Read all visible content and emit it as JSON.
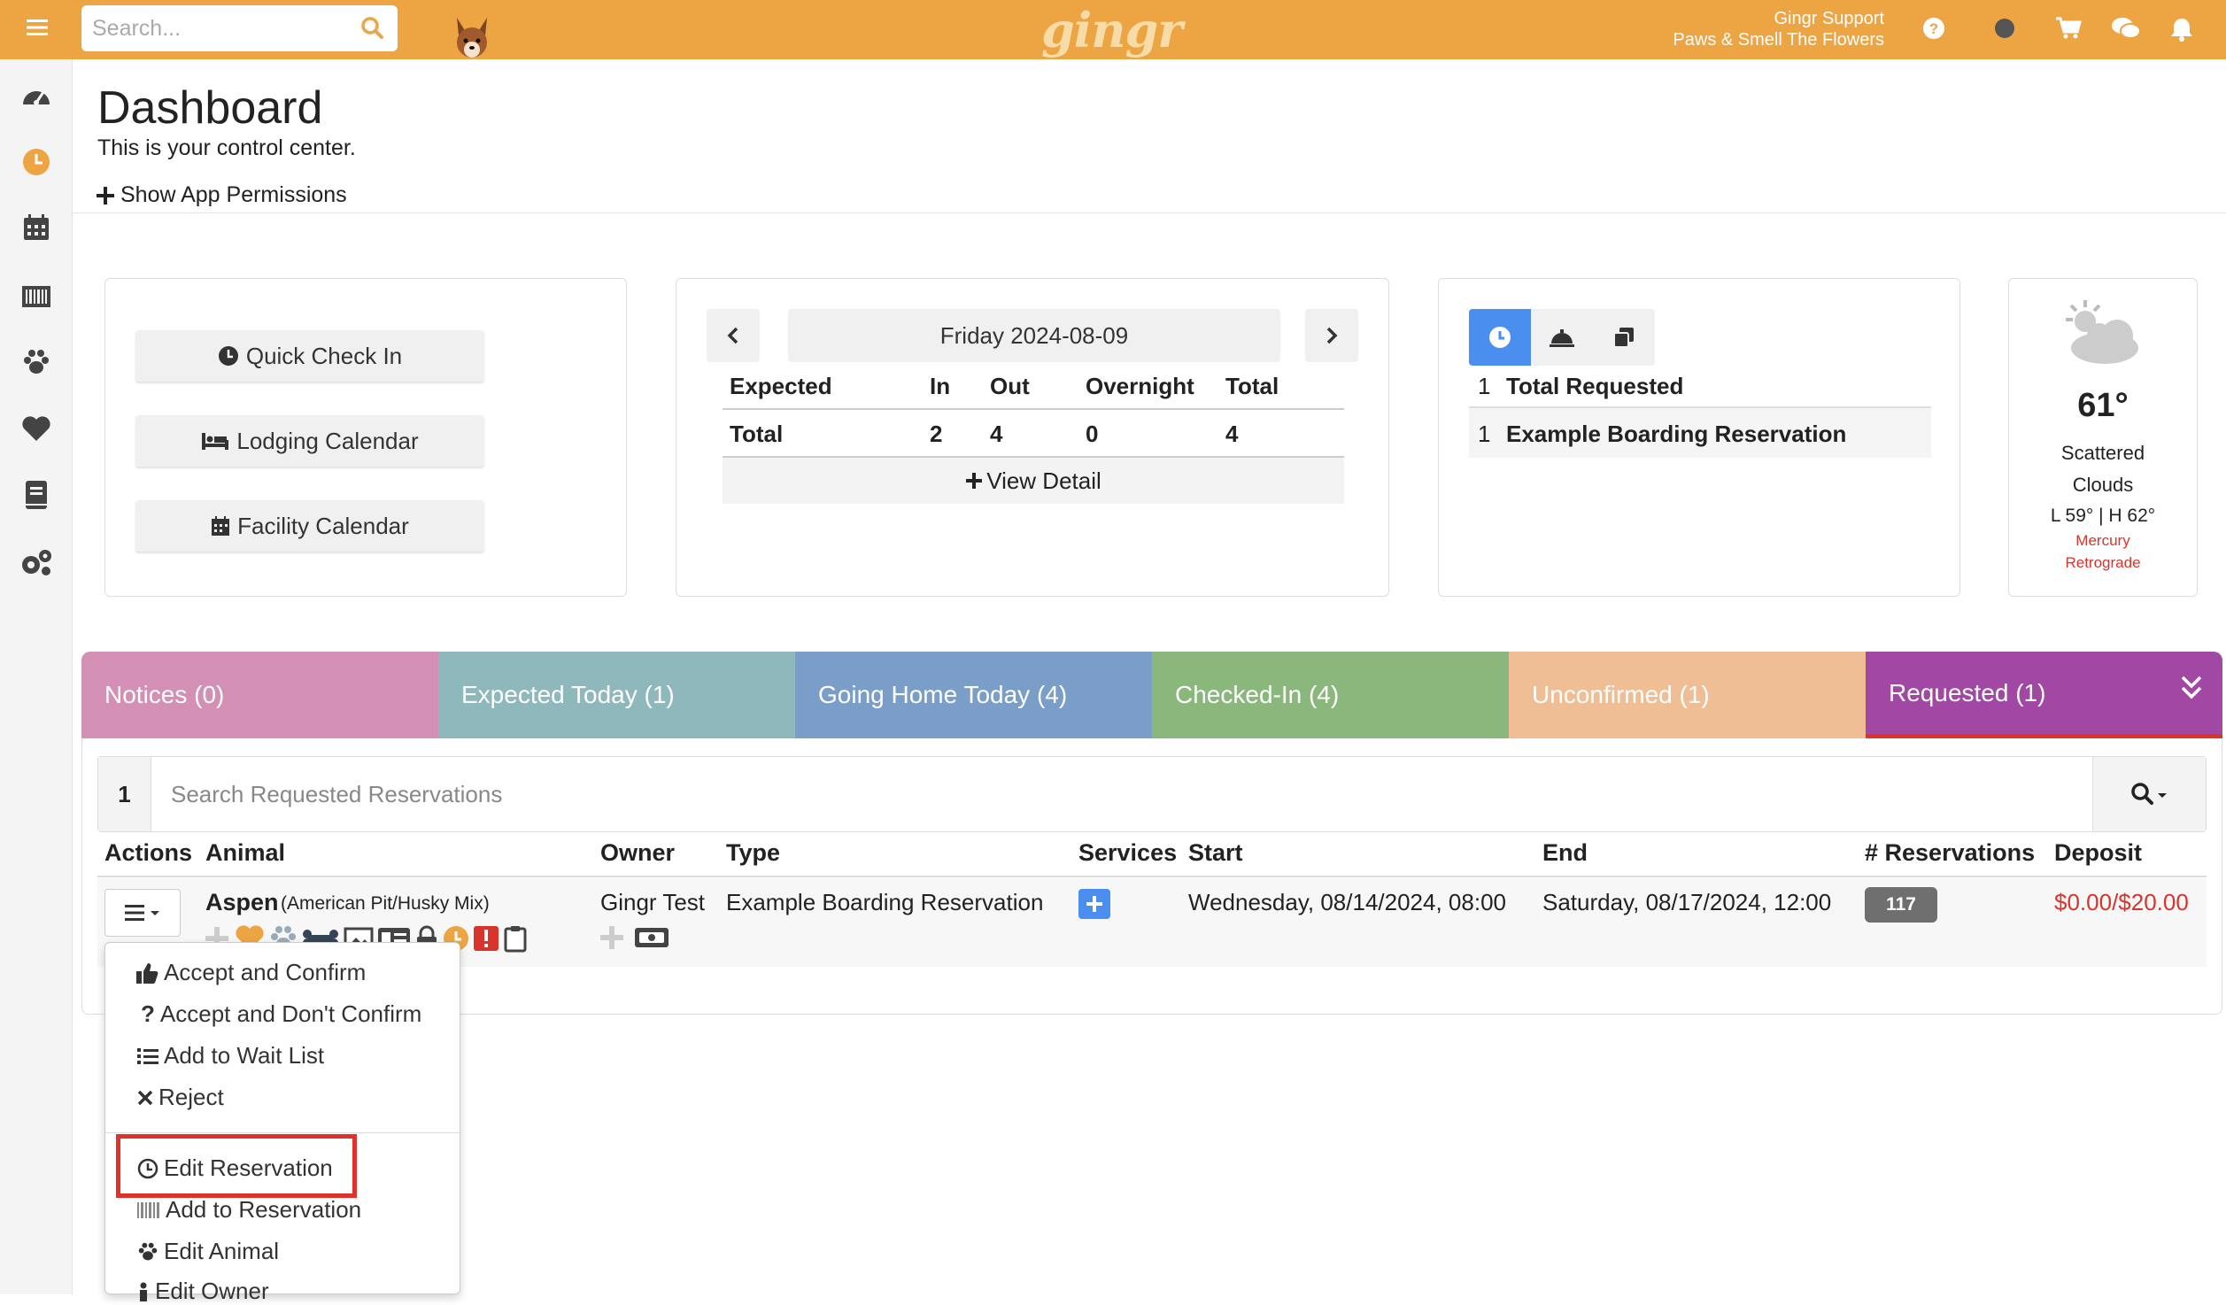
{
  "topbar": {
    "search_placeholder": "Search...",
    "logo": "gingr",
    "user_name": "Gingr Support",
    "user_org": "Paws & Smell The Flowers"
  },
  "header": {
    "title": "Dashboard",
    "subtitle": "This is your control center.",
    "permissions": "Show App Permissions"
  },
  "quick_buttons": [
    "Quick Check In",
    "Lodging Calendar",
    "Facility Calendar"
  ],
  "grid": {
    "date": "Friday 2024-08-09",
    "headers": [
      "Expected",
      "In",
      "Out",
      "Overnight",
      "Total"
    ],
    "total_label": "Total",
    "in": "2",
    "out": "4",
    "overnight": "0",
    "total": "4",
    "view_detail": "View Detail"
  },
  "requests": {
    "rows": [
      {
        "count": "1",
        "label": "Total Requested"
      },
      {
        "count": "1",
        "label": "Example Boarding Reservation"
      }
    ]
  },
  "weather": {
    "temp": "61°",
    "desc1": "Scattered",
    "desc2": "Clouds",
    "range": "L 59° | H 62°",
    "note1": "Mercury",
    "note2": "Retrograde"
  },
  "tabs": [
    {
      "label": "Notices (0)",
      "color": "#d48fb4"
    },
    {
      "label": "Expected Today (1)",
      "color": "#8fb8bd"
    },
    {
      "label": "Going Home Today (4)",
      "color": "#7a9ec8"
    },
    {
      "label": "Checked-In (4)",
      "color": "#8ab87c"
    },
    {
      "label": "Unconfirmed (1)",
      "color": "#f0be94"
    },
    {
      "label": "Requested (1)",
      "color": "#a147a4"
    }
  ],
  "search_bar": {
    "count": "1",
    "placeholder": "Search Requested Reservations"
  },
  "table": {
    "headers": [
      "Actions",
      "Animal",
      "Owner",
      "Type",
      "Services",
      "Start",
      "End",
      "# Reservations",
      "Deposit"
    ],
    "row": {
      "animal": "Aspen",
      "breed": "(American Pit/Husky Mix)",
      "owner": "Gingr Test",
      "type": "Example Boarding Reservation",
      "start": "Wednesday, 08/14/2024, 08:00",
      "end": "Saturday, 08/17/2024, 12:00",
      "reservations": "117",
      "deposit": "$0.00/$20.00"
    }
  },
  "dropdown": [
    "Accept and Confirm",
    "Accept and Don't Confirm",
    "Add to Wait List",
    "Reject",
    "Edit Reservation",
    "Add to Reservation",
    "Edit Animal",
    "Edit Owner"
  ],
  "colors": {
    "brand": "#eda443",
    "highlight": "#e0312b",
    "deposit": "#d9342b",
    "accent_blue": "#4a8ef0",
    "active_tab_border": "#e0312b"
  }
}
